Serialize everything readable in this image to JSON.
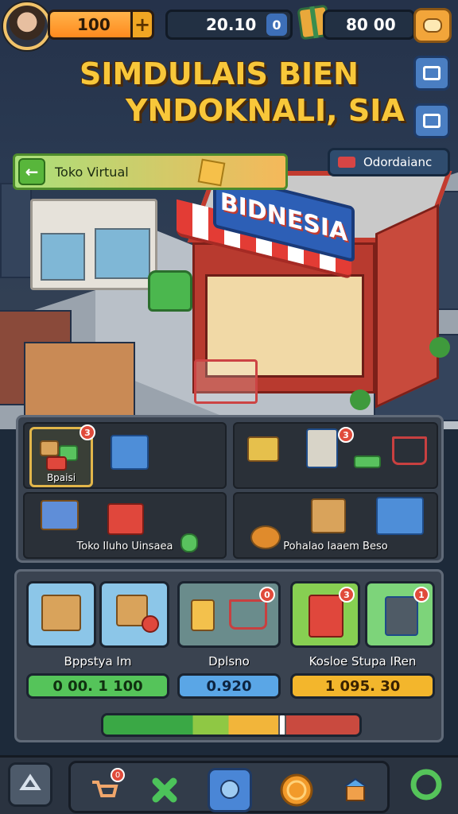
{
  "hud": {
    "coins": "100",
    "coins_plus": "+",
    "money": "20.10",
    "money_badge": "0",
    "gems": "80 00"
  },
  "title": {
    "line1": "SIMDULAIS BIEN",
    "line2": "YNDOKNALI, SIA"
  },
  "banner": {
    "back_symbol": "←",
    "label": "Toko Virtual"
  },
  "tag_button": {
    "label": "Odordaianc"
  },
  "store_sign": "BIDNESIA",
  "panel_left": {
    "selected_label": "Bpaisi",
    "selected_badge": "3",
    "bottom_label": "Toko Iluho Uinsaea"
  },
  "panel_right": {
    "badge": "3",
    "bottom_label": "Pohalao Iaaem Beso"
  },
  "cards": {
    "group1": {
      "label": "Bppstya Im",
      "price": "0 00. 1 100"
    },
    "group2": {
      "label": "Dplsno",
      "price": "0.920",
      "badge": "0"
    },
    "group3": {
      "label": "Kosloe Stupa IRen",
      "price": "1 095. 30",
      "badge_a": "3",
      "badge_b": "1"
    }
  },
  "progress": {
    "fraction": 0.7
  },
  "nav": {
    "cart_badge": "0"
  },
  "colors": {
    "accent_gold": "#f8c73a",
    "coins_orange": "#ff8a1e",
    "store_red": "#b83a2f",
    "sign_blue": "#2d5fb6"
  }
}
